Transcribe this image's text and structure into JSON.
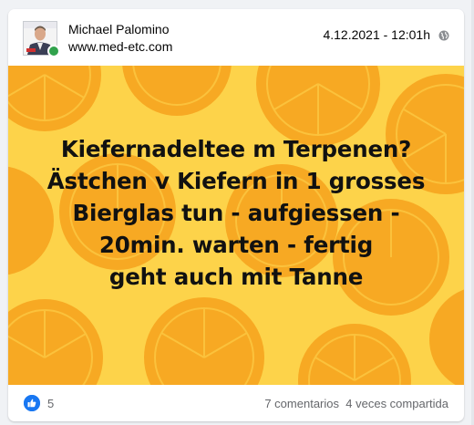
{
  "post": {
    "author_name": "Michael Palomino",
    "author_site": "www.med-etc.com",
    "timestamp": "4.12.2021 - 12:01h",
    "privacy_icon": "globe-icon",
    "avatar_icon": "avatar-icon",
    "online_status_color": "#31a24c",
    "image": {
      "background_color": "#fdd34a",
      "lemon_color": "#f7a923",
      "text_lines": [
        "Kiefernadeltee m Terpenen?",
        "Ästchen v Kiefern in 1 grosses",
        "Bierglas tun - aufgiessen -",
        "20min. warten - fertig",
        "geht auch mit Tanne"
      ]
    },
    "reactions": {
      "icon": "like-icon",
      "count": "5",
      "accent_color": "#1877f2"
    },
    "comments_label": "7 comentarios",
    "shares_label": "4 veces compartida"
  }
}
